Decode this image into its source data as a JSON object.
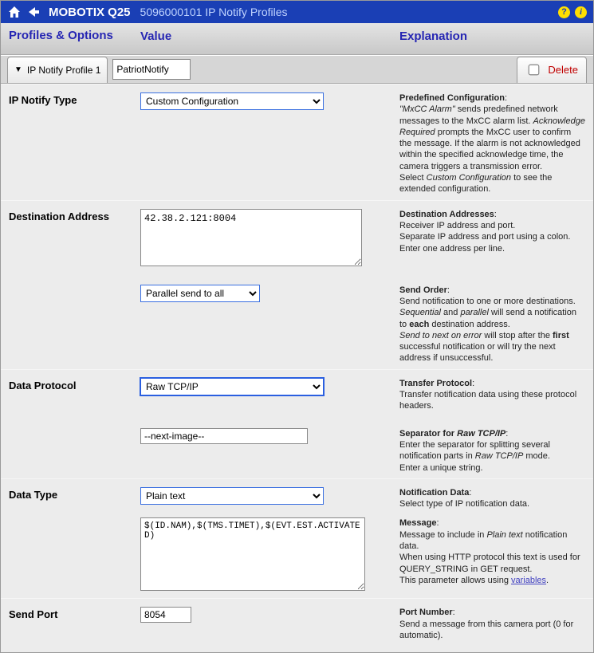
{
  "titlebar": {
    "brand": "MOBOTIX Q25",
    "subtitle": "5096000101 IP Notify Profiles"
  },
  "columns": {
    "profiles": "Profiles & Options",
    "value": "Value",
    "explanation": "Explanation"
  },
  "profile_tab": {
    "label": "IP Notify Profile 1",
    "name_value": "PatriotNotify",
    "delete_label": "Delete"
  },
  "rows": {
    "ip_notify_type": {
      "label": "IP Notify Type",
      "select_value": "Custom Configuration",
      "expl_title": "Predefined Configuration",
      "expl_1a": "\"MxCC Alarm\"",
      "expl_1b": " sends predefined network messages to the MxCC alarm list. ",
      "expl_1c": "Acknowledge Required",
      "expl_1d": " prompts the MxCC user to confirm the message. If the alarm is not acknowledged within the specified acknowledge time, the camera triggers a transmission error.",
      "expl_2a": "Select ",
      "expl_2b": "Custom Configuration",
      "expl_2c": " to see the extended configuration."
    },
    "destination": {
      "label": "Destination Address",
      "value": "42.38.2.121:8004",
      "expl_title": "Destination Addresses",
      "expl_body": "Receiver IP address and port.\nSeparate IP address and port using a colon.\nEnter one address per line."
    },
    "send_order": {
      "select_value": "Parallel send to all",
      "expl_title": "Send Order",
      "expl_1": "Send notification to one or more destinations.",
      "expl_2a": "Sequential",
      "expl_2b": " and ",
      "expl_2c": "parallel",
      "expl_2d": " will send a notification to ",
      "expl_2e": "each",
      "expl_2f": " destination address.",
      "expl_3a": "Send to next on error",
      "expl_3b": " will stop after the ",
      "expl_3c": "first",
      "expl_3d": " successful notification or will try the next address if unsuccessful."
    },
    "data_protocol": {
      "label": "Data Protocol",
      "select_value": "Raw TCP/IP",
      "expl_title": "Transfer Protocol",
      "expl_body": "Transfer notification data using these protocol headers."
    },
    "separator": {
      "value": "--next-image--",
      "expl_title_a": "Separator for ",
      "expl_title_b": "Raw TCP/IP",
      "expl_1a": "Enter the separator for splitting several notification parts in ",
      "expl_1b": "Raw TCP/IP",
      "expl_1c": " mode.",
      "expl_2": "Enter a unique string."
    },
    "data_type": {
      "label": "Data Type",
      "select_value": "Plain text",
      "expl_title": "Notification Data",
      "expl_body": "Select type of IP notification data."
    },
    "message": {
      "value": "$(ID.NAM),$(TMS.TIMET),$(EVT.EST.ACTIVATED)",
      "expl_title": "Message",
      "expl_1a": "Message to include in ",
      "expl_1b": "Plain text",
      "expl_1c": " notification data.",
      "expl_2": "When using HTTP protocol this text is used for QUERY_STRING in GET request.",
      "expl_3a": "This parameter allows using ",
      "expl_3b": "variables",
      "expl_3c": "."
    },
    "send_port": {
      "label": "Send Port",
      "value": "8054",
      "expl_title": "Port Number",
      "expl_body": "Send a message from this camera port (0 for automatic)."
    }
  }
}
